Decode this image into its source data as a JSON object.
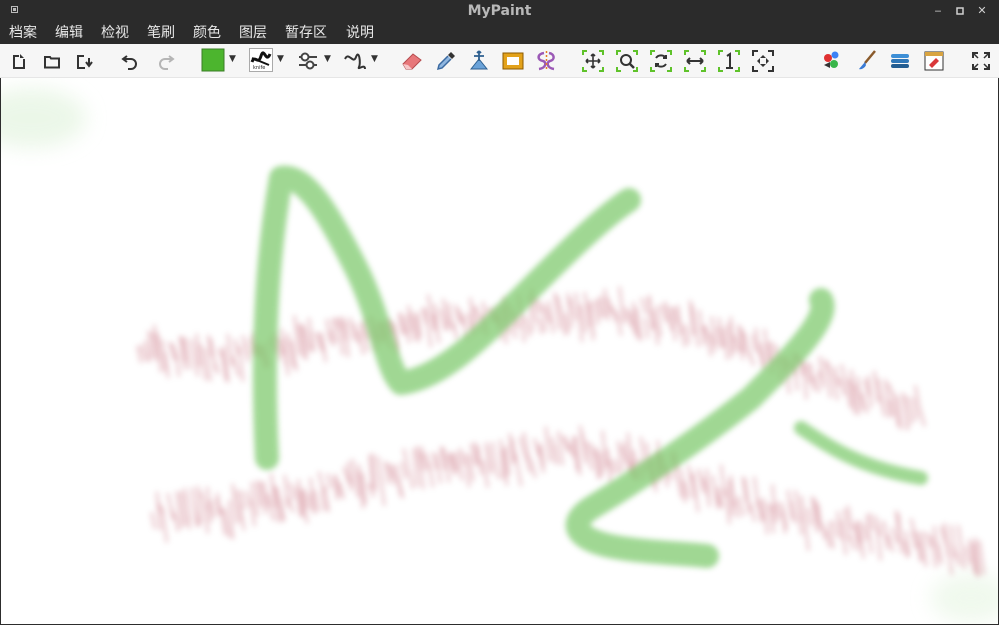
{
  "window": {
    "title": "MyPaint"
  },
  "menu": {
    "items": [
      {
        "label": "档案"
      },
      {
        "label": "编辑"
      },
      {
        "label": "检视"
      },
      {
        "label": "笔刷"
      },
      {
        "label": "颜色"
      },
      {
        "label": "图层"
      },
      {
        "label": "暂存区"
      },
      {
        "label": "说明"
      }
    ]
  },
  "toolbar": {
    "current_color": "#4cb52e",
    "brush_tag": "knife",
    "tools": [
      "new-document-icon",
      "open-folder-icon",
      "save-as-icon",
      "undo-icon",
      "redo-icon",
      "color-swatch",
      "brush-selector",
      "brush-settings-icon",
      "brush-curve-icon",
      "eraser-icon",
      "color-picker-icon",
      "pan-tool-icon",
      "frame-tool-icon",
      "symmetry-tool-icon",
      "view-pan-icon",
      "view-zoom-icon",
      "view-rotate-icon",
      "view-mirror-icon",
      "view-reset-1-icon",
      "view-fit-icon",
      "color-palette-icon",
      "brush-panel-icon",
      "layers-icon",
      "scratchpad-icon",
      "fullscreen-icon"
    ]
  },
  "canvas": {
    "background": "#ffffff",
    "stroke_colors": {
      "green": "#7cc96a",
      "pink": "#c9707e"
    }
  }
}
